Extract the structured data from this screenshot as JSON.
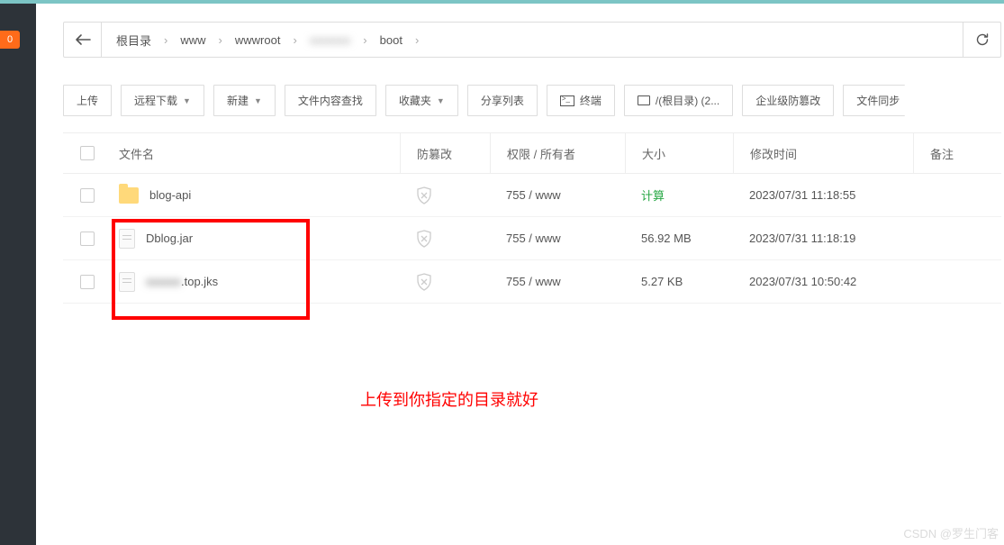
{
  "sidebar": {
    "badge": "0"
  },
  "breadcrumb": {
    "items": [
      "根目录",
      "www",
      "wwwroot",
      "",
      "boot"
    ],
    "blurred_index": 3
  },
  "toolbar": {
    "upload": "上传",
    "remote_download": "远程下载",
    "new": "新建",
    "content_search": "文件内容查找",
    "favorites": "收藏夹",
    "share_list": "分享列表",
    "terminal": "终端",
    "disk_root": "/(根目录) (2...",
    "enterprise_tamper": "企业级防篡改",
    "file_sync": "文件同步"
  },
  "columns": {
    "name": "文件名",
    "tamper": "防篡改",
    "perm": "权限 / 所有者",
    "size": "大小",
    "mtime": "修改时间",
    "remark": "备注"
  },
  "rows": [
    {
      "type": "folder",
      "name": "blog-api",
      "perm": "755 / www",
      "size": "计算",
      "size_is_link": true,
      "mtime": "2023/07/31 11:18:55"
    },
    {
      "type": "file",
      "name": "Dblog.jar",
      "perm": "755 / www",
      "size": "56.92 MB",
      "size_is_link": false,
      "mtime": "2023/07/31 11:18:19"
    },
    {
      "type": "file",
      "name": ".top.jks",
      "name_blur_prefix": true,
      "perm": "755 / www",
      "size": "5.27 KB",
      "size_is_link": false,
      "mtime": "2023/07/31 10:50:42"
    }
  ],
  "annotation_text": "上传到你指定的目录就好",
  "watermark": "CSDN @罗生门客"
}
